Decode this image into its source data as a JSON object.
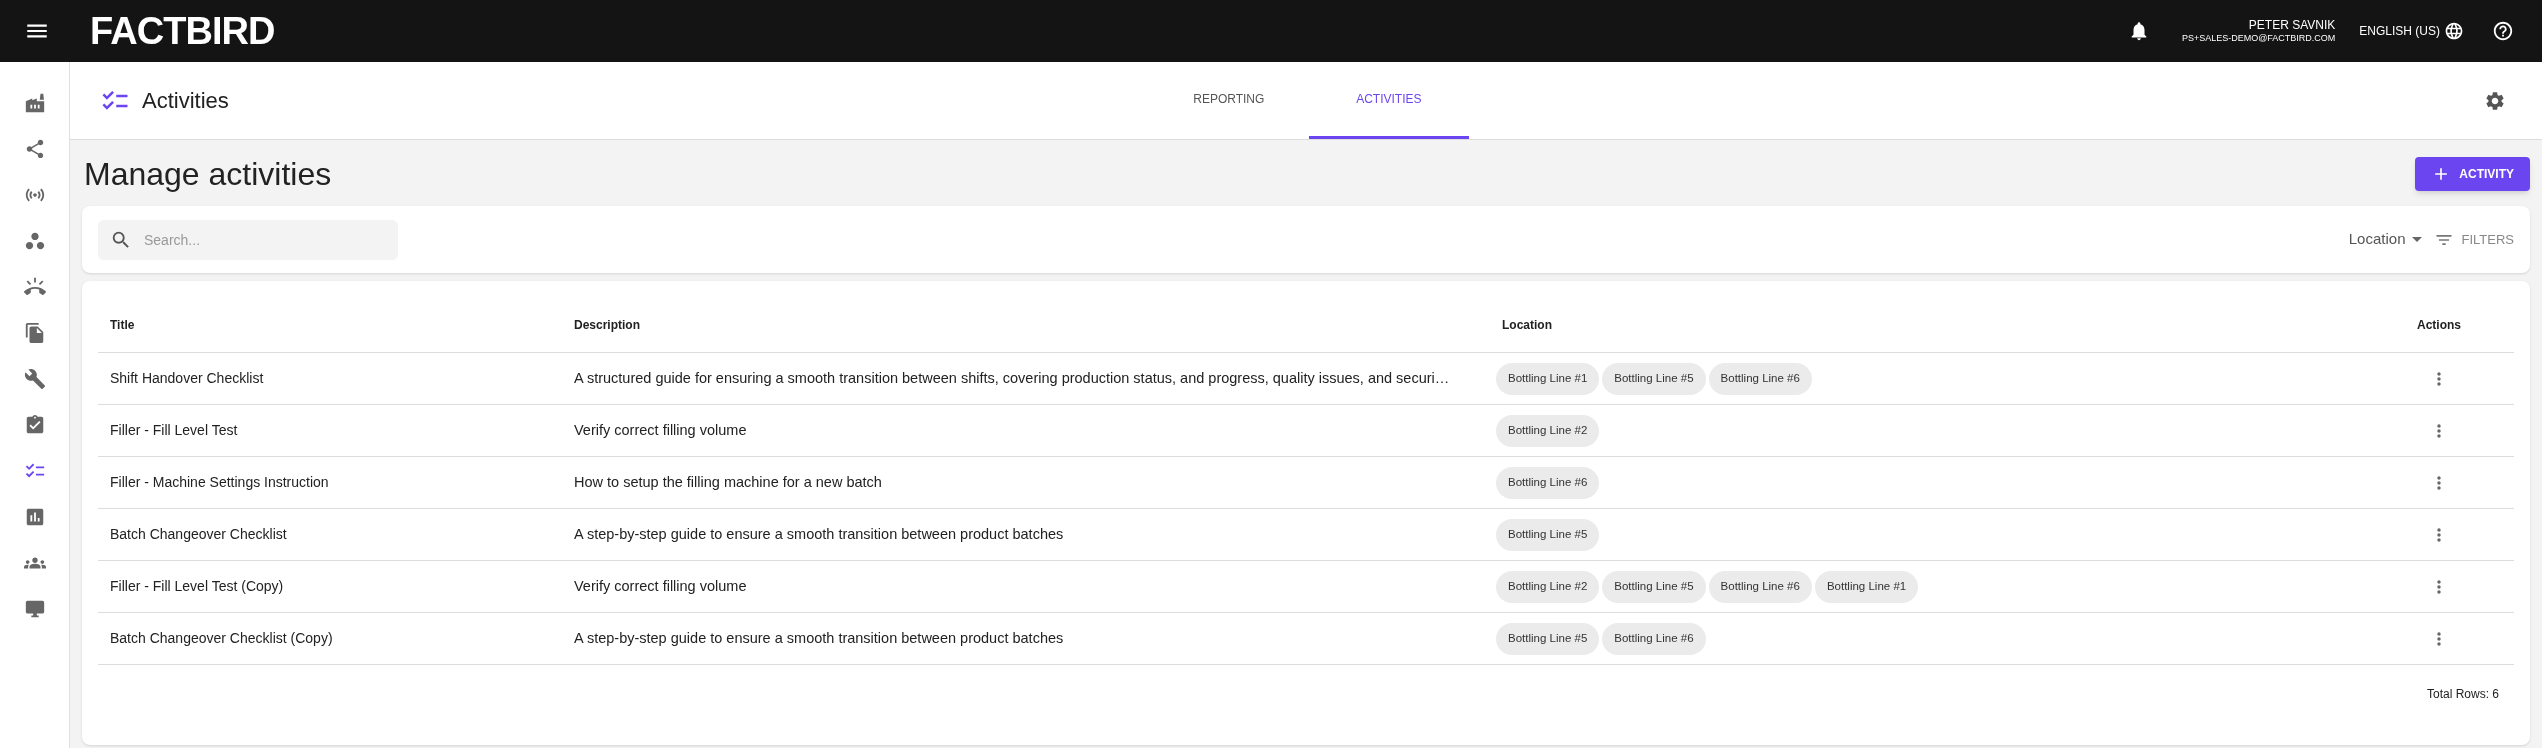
{
  "app_bar": {
    "logo": "FACTBIRD",
    "user_name": "PETER SAVNIK",
    "user_email": "PS+SALES-DEMO@FACTBIRD.COM",
    "language": "ENGLISH (US)"
  },
  "sidebar": {
    "items": [
      {
        "kind": "factory",
        "selected": false
      },
      {
        "kind": "nodes",
        "selected": false
      },
      {
        "kind": "sensor",
        "selected": false
      },
      {
        "kind": "workspaces",
        "selected": false
      },
      {
        "kind": "ring",
        "selected": false
      },
      {
        "kind": "files",
        "selected": false
      },
      {
        "kind": "wrench",
        "selected": false
      },
      {
        "kind": "clipboard",
        "selected": false
      },
      {
        "kind": "checklist",
        "selected": true
      },
      {
        "kind": "chart",
        "selected": false
      },
      {
        "kind": "groups",
        "selected": false
      },
      {
        "kind": "monitor",
        "selected": false
      }
    ]
  },
  "header": {
    "title": "Activities",
    "tabs": [
      {
        "label": "REPORTING",
        "selected": false
      },
      {
        "label": "ACTIVITIES",
        "selected": true
      }
    ]
  },
  "page": {
    "title": "Manage activities",
    "add_button": "ACTIVITY"
  },
  "filter_bar": {
    "search": {
      "placeholder": "Search..."
    },
    "location_dropdown": "Location",
    "filters_button": "FILTERS"
  },
  "table": {
    "columns": [
      "Title",
      "Description",
      "Location",
      "Actions"
    ],
    "rows": [
      {
        "title": "Shift Handover Checklist",
        "description": "A structured guide for ensuring a smooth transition between shifts, covering production status, and progress, quality issues, and securi…",
        "locations": [
          "Bottling Line #1",
          "Bottling Line #5",
          "Bottling Line #6"
        ]
      },
      {
        "title": "Filler - Fill Level Test",
        "description": "Verify correct filling volume",
        "locations": [
          "Bottling Line #2"
        ]
      },
      {
        "title": "Filler - Machine Settings Instruction",
        "description": "How to setup the filling machine for a new batch",
        "locations": [
          "Bottling Line #6"
        ]
      },
      {
        "title": "Batch Changeover Checklist",
        "description": "A step-by-step guide to ensure a smooth transition between product batches",
        "locations": [
          "Bottling Line #5"
        ]
      },
      {
        "title": "Filler - Fill Level Test (Copy)",
        "description": "Verify correct filling volume",
        "locations": [
          "Bottling Line #2",
          "Bottling Line #5",
          "Bottling Line #6",
          "Bottling Line #1"
        ]
      },
      {
        "title": "Batch Changeover Checklist (Copy)",
        "description": "A step-by-step guide to ensure a smooth transition between product batches",
        "locations": [
          "Bottling Line #5",
          "Bottling Line #6"
        ]
      }
    ],
    "total": "Total Rows: 6"
  }
}
